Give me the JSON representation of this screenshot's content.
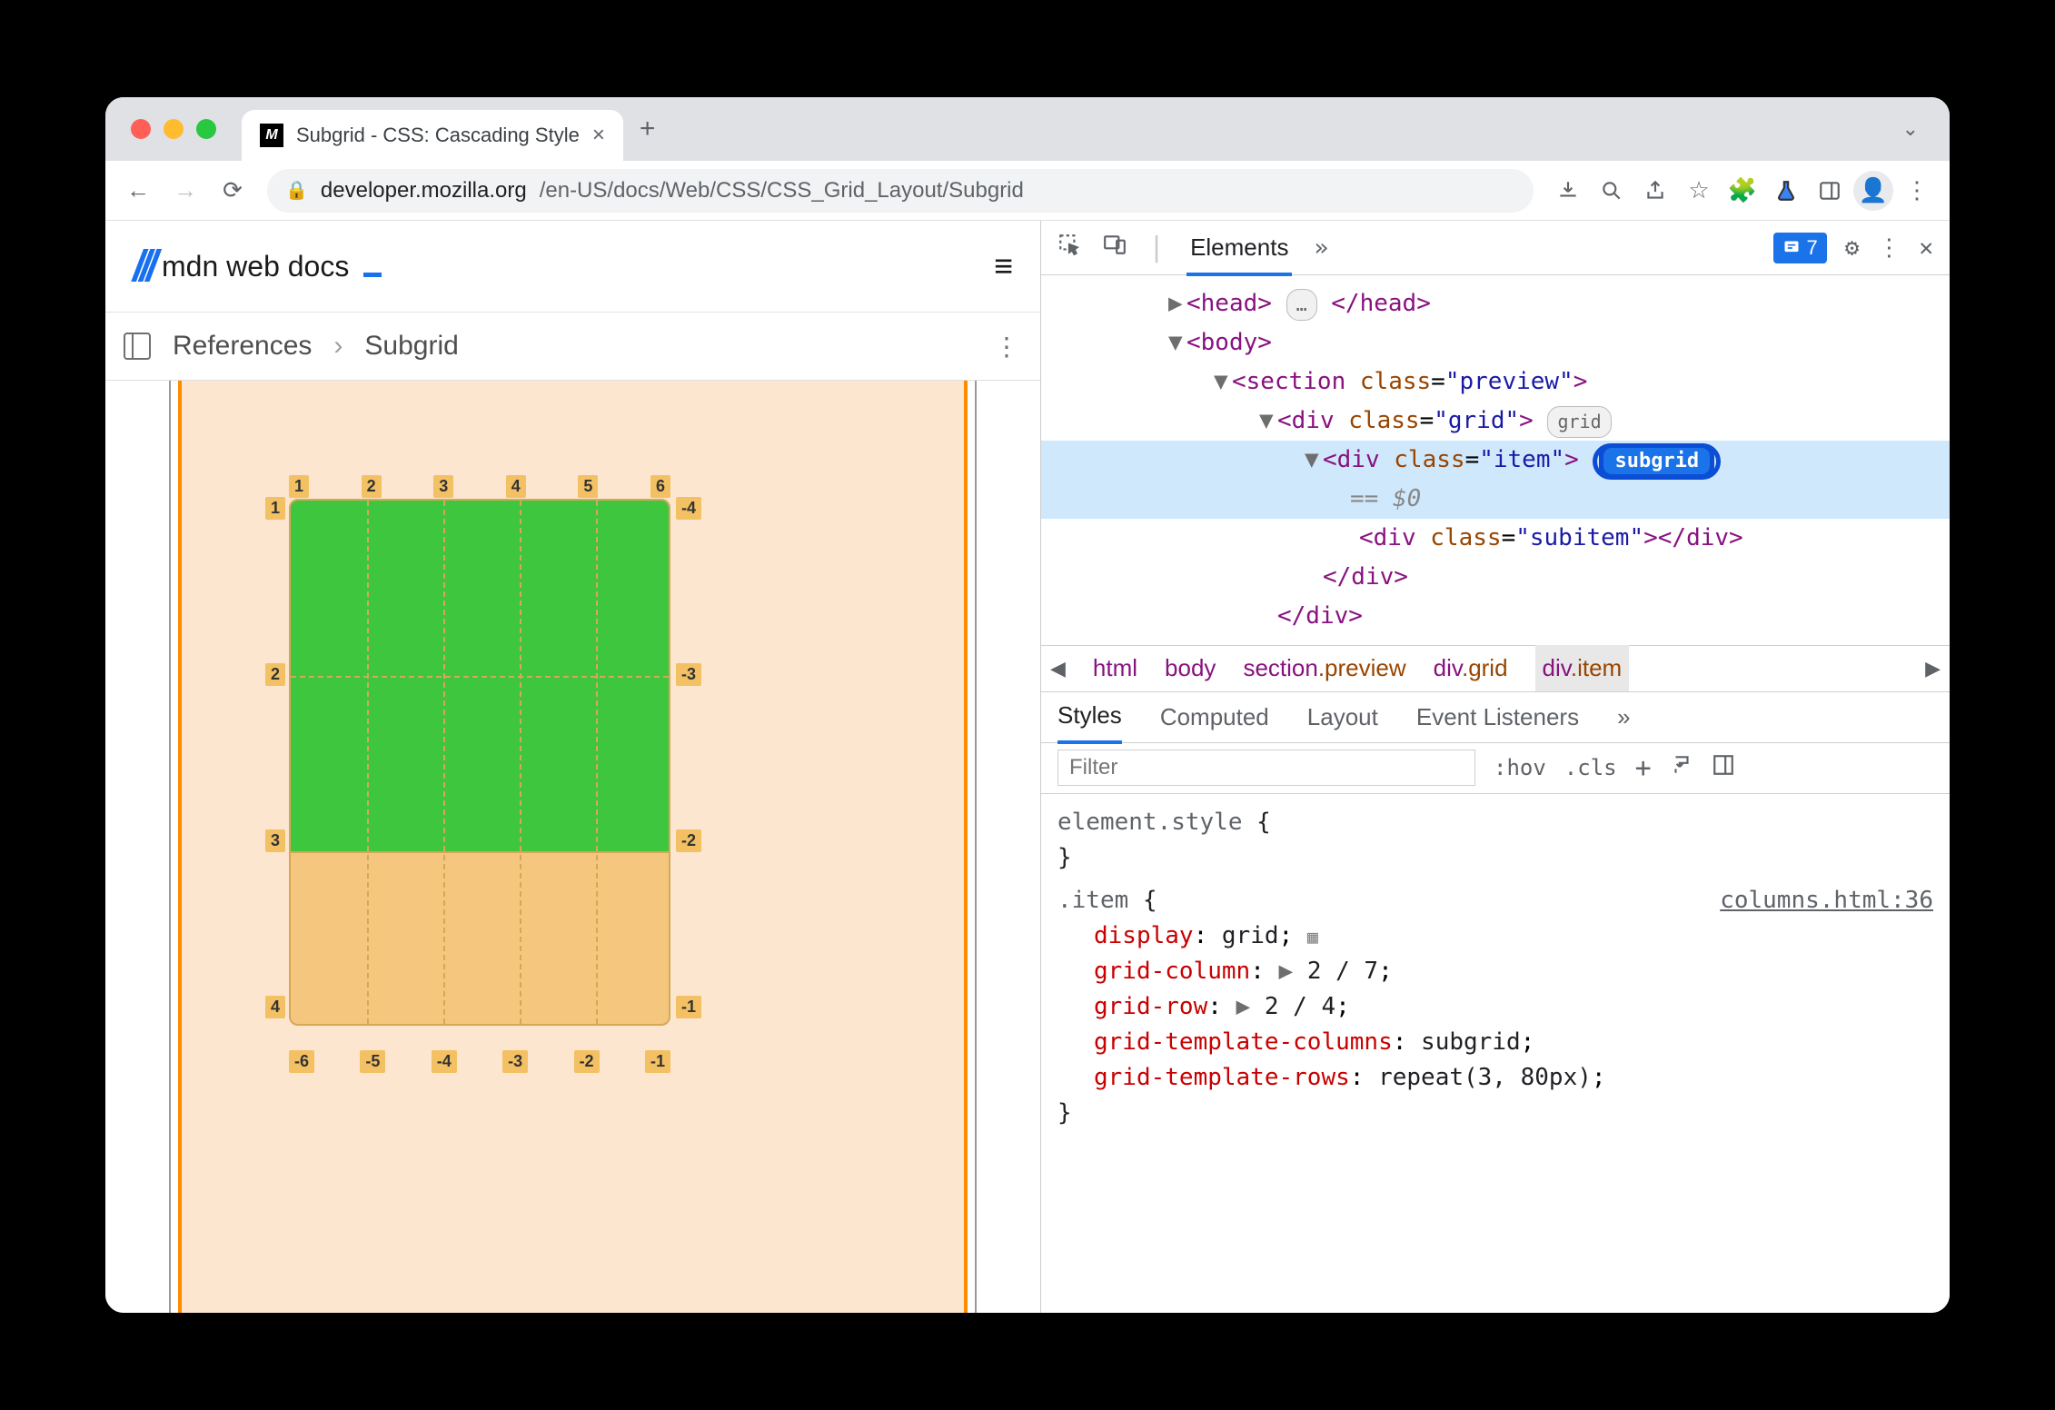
{
  "tab": {
    "title": "Subgrid - CSS: Cascading Style"
  },
  "url": {
    "host": "developer.mozilla.org",
    "path": "/en-US/docs/Web/CSS/CSS_Grid_Layout/Subgrid"
  },
  "mdn": {
    "logo": "mdn web docs"
  },
  "breadcrumb": {
    "references": "References",
    "current": "Subgrid"
  },
  "grid_labels": {
    "top": [
      "1",
      "2",
      "3",
      "4",
      "5",
      "6"
    ],
    "left": [
      "1",
      "2",
      "3",
      "4"
    ],
    "right": [
      "-4",
      "-3",
      "-2",
      "-1"
    ],
    "bottom": [
      "-6",
      "-5",
      "-4",
      "-3",
      "-2",
      "-1"
    ]
  },
  "devtools": {
    "tab_elements": "Elements",
    "issue_count": "7"
  },
  "dom": {
    "head_open": "<head>",
    "head_ell": "…",
    "head_close": "</head>",
    "body_open": "<body>",
    "section": {
      "tag": "section",
      "attr": "class",
      "val": "\"preview\""
    },
    "grid": {
      "tag": "div",
      "attr": "class",
      "val": "\"grid\"",
      "badge": "grid"
    },
    "item": {
      "tag": "div",
      "attr": "class",
      "val": "\"item\"",
      "badge": "subgrid"
    },
    "dollar": "== $0",
    "subitem": "<div class=\"subitem\"></div>",
    "close_div": "</div>"
  },
  "crumbs": {
    "html": "html",
    "body": "body",
    "section": "section",
    "section_cls": ".preview",
    "grid": "div",
    "grid_cls": ".grid",
    "item": "div",
    "item_cls": ".item"
  },
  "styles_tabs": {
    "styles": "Styles",
    "computed": "Computed",
    "layout": "Layout",
    "event": "Event Listeners"
  },
  "filter": {
    "placeholder": "Filter",
    "hov": ":hov",
    "cls": ".cls"
  },
  "css": {
    "element_style": "element.style",
    "item_sel": ".item",
    "src": "columns.html:36",
    "p1n": "display",
    "p1v": "grid",
    "p2n": "grid-column",
    "p2v": "2 / 7",
    "p3n": "grid-row",
    "p3v": "2 / 4",
    "p4n": "grid-template-columns",
    "p4v": "subgrid",
    "p5n": "grid-template-rows",
    "p5v": "repeat(3, 80px)"
  }
}
